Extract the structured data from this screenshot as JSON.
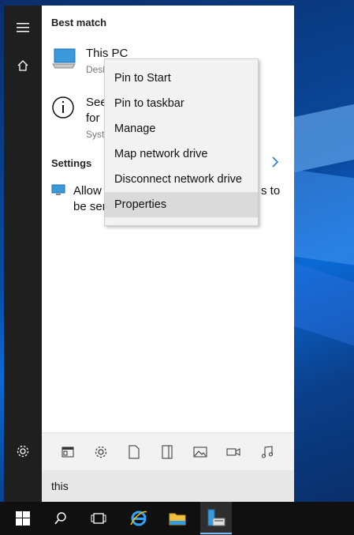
{
  "search": {
    "query": "this"
  },
  "best_match": {
    "heading": "Best match",
    "title": "This PC",
    "subtitle": "Desk"
  },
  "second_result": {
    "line1": "See",
    "line2": "for",
    "subtitle": "Syst"
  },
  "settings": {
    "heading": "Settings",
    "item_line1_prefix": "Allow",
    "item_line1_suffix": "s to",
    "item_line2": "be ser"
  },
  "context_menu": {
    "items": [
      {
        "label": "Pin to Start"
      },
      {
        "label": "Pin to taskbar"
      },
      {
        "label": "Manage"
      },
      {
        "label": "Map network drive"
      },
      {
        "label": "Disconnect network drive"
      },
      {
        "label": "Properties"
      }
    ],
    "highlighted": "Properties"
  },
  "filters": [
    "apps-filter-icon",
    "settings-filter-icon",
    "documents-filter-icon",
    "folders-filter-icon",
    "photos-filter-icon",
    "videos-filter-icon",
    "music-filter-icon"
  ],
  "colors": {
    "rail": "#1f1f1f",
    "taskbar": "#101010",
    "accent": "#2b7cd3",
    "highlight": "#dadada"
  }
}
